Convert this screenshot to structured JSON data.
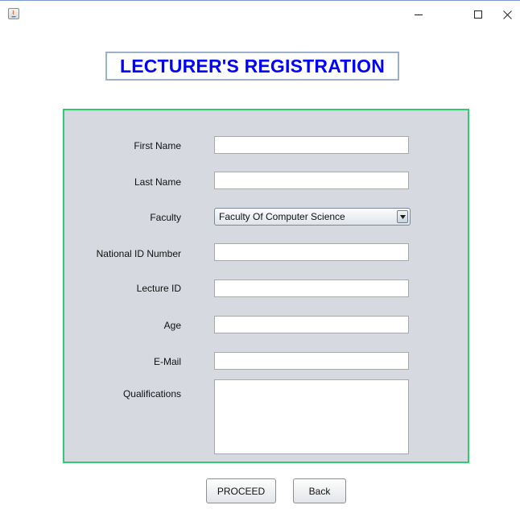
{
  "window": {
    "title": "",
    "controls": {
      "minimize_icon": "minimize-icon",
      "maximize_icon": "maximize-icon",
      "close_icon": "close-icon"
    }
  },
  "heading": {
    "title": "LECTURER'S REGISTRATION",
    "color": "#0000ff"
  },
  "form": {
    "panel_border_color": "#2ecc71",
    "panel_background": "#d6d9df",
    "fields": {
      "first_name": {
        "label": "First Name",
        "value": ""
      },
      "last_name": {
        "label": "Last Name",
        "value": ""
      },
      "faculty": {
        "label": "Faculty",
        "selected": "Faculty Of Computer Science"
      },
      "national_id": {
        "label": "National ID Number",
        "value": ""
      },
      "lecture_id": {
        "label": "Lecture ID",
        "value": ""
      },
      "age": {
        "label": "Age",
        "value": ""
      },
      "email": {
        "label": "E-Mail",
        "value": ""
      },
      "qualifications": {
        "label": "Qualifications",
        "value": ""
      }
    }
  },
  "actions": {
    "proceed_label": "PROCEED",
    "back_label": "Back"
  }
}
